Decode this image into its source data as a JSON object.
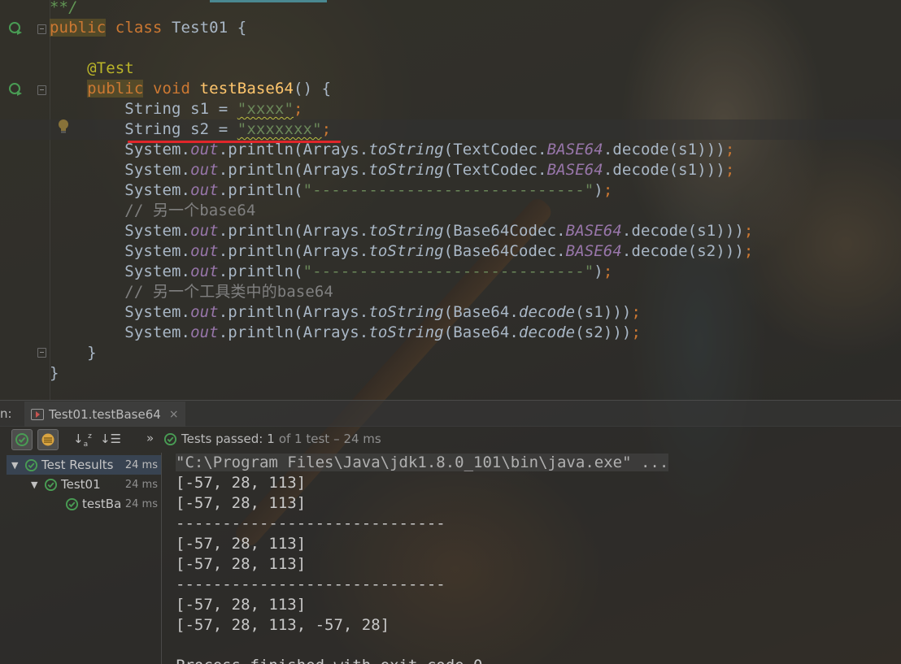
{
  "editor": {
    "lines": [
      [
        {
          "t": "**/",
          "c": "doc"
        }
      ],
      [
        {
          "t": "public",
          "c": "kw hl"
        },
        {
          "t": " "
        },
        {
          "t": "class",
          "c": "kw"
        },
        {
          "t": " Test01 {"
        }
      ],
      [],
      [
        {
          "t": "    @Test",
          "c": "ann"
        }
      ],
      [
        {
          "t": "    "
        },
        {
          "t": "public",
          "c": "kw hl"
        },
        {
          "t": " "
        },
        {
          "t": "void",
          "c": "kw"
        },
        {
          "t": " "
        },
        {
          "t": "testBase64",
          "c": "fn"
        },
        {
          "t": "() {"
        }
      ],
      [
        {
          "t": "        String s1 = "
        },
        {
          "t": "\"xxxx\"",
          "c": "str warn"
        },
        {
          "t": ";",
          "c": "punc"
        }
      ],
      [
        {
          "t": "        String s2 = "
        },
        {
          "t": "\"xxxxxxx\"",
          "c": "str warn"
        },
        {
          "t": ";",
          "c": "punc"
        }
      ],
      [
        {
          "t": "        System."
        },
        {
          "t": "out",
          "c": "field"
        },
        {
          "t": ".println(Arrays."
        },
        {
          "t": "toString",
          "c": "static"
        },
        {
          "t": "(TextCodec."
        },
        {
          "t": "BASE64",
          "c": "field"
        },
        {
          "t": ".decode(s1)))"
        },
        {
          "t": ";",
          "c": "punc"
        }
      ],
      [
        {
          "t": "        System."
        },
        {
          "t": "out",
          "c": "field"
        },
        {
          "t": ".println(Arrays."
        },
        {
          "t": "toString",
          "c": "static"
        },
        {
          "t": "(TextCodec."
        },
        {
          "t": "BASE64",
          "c": "field"
        },
        {
          "t": ".decode(s1)))"
        },
        {
          "t": ";",
          "c": "punc"
        }
      ],
      [
        {
          "t": "        System."
        },
        {
          "t": "out",
          "c": "field"
        },
        {
          "t": ".println("
        },
        {
          "t": "\"-----------------------------\"",
          "c": "str"
        },
        {
          "t": ")"
        },
        {
          "t": ";",
          "c": "punc"
        }
      ],
      [
        {
          "t": "        // 另一个base64",
          "c": "comment"
        }
      ],
      [
        {
          "t": "        System."
        },
        {
          "t": "out",
          "c": "field"
        },
        {
          "t": ".println(Arrays."
        },
        {
          "t": "toString",
          "c": "static"
        },
        {
          "t": "(Base64Codec."
        },
        {
          "t": "BASE64",
          "c": "field"
        },
        {
          "t": ".decode(s1)))"
        },
        {
          "t": ";",
          "c": "punc"
        }
      ],
      [
        {
          "t": "        System."
        },
        {
          "t": "out",
          "c": "field"
        },
        {
          "t": ".println(Arrays."
        },
        {
          "t": "toString",
          "c": "static"
        },
        {
          "t": "(Base64Codec."
        },
        {
          "t": "BASE64",
          "c": "field"
        },
        {
          "t": ".decode(s2)))"
        },
        {
          "t": ";",
          "c": "punc"
        }
      ],
      [
        {
          "t": "        System."
        },
        {
          "t": "out",
          "c": "field"
        },
        {
          "t": ".println("
        },
        {
          "t": "\"-----------------------------\"",
          "c": "str"
        },
        {
          "t": ")"
        },
        {
          "t": ";",
          "c": "punc"
        }
      ],
      [
        {
          "t": "        // 另一个工具类中的base64",
          "c": "comment"
        }
      ],
      [
        {
          "t": "        System."
        },
        {
          "t": "out",
          "c": "field"
        },
        {
          "t": ".println(Arrays."
        },
        {
          "t": "toString",
          "c": "static"
        },
        {
          "t": "(Base64."
        },
        {
          "t": "decode",
          "c": "static"
        },
        {
          "t": "(s1)))"
        },
        {
          "t": ";",
          "c": "punc"
        }
      ],
      [
        {
          "t": "        System."
        },
        {
          "t": "out",
          "c": "field"
        },
        {
          "t": ".println(Arrays."
        },
        {
          "t": "toString",
          "c": "static"
        },
        {
          "t": "(Base64."
        },
        {
          "t": "decode",
          "c": "static"
        },
        {
          "t": "(s2)))"
        },
        {
          "t": ";",
          "c": "punc"
        }
      ],
      [
        {
          "t": "    }"
        }
      ],
      [
        {
          "t": "}"
        }
      ]
    ]
  },
  "run": {
    "label": "n:",
    "tab_title": "Test01.testBase64",
    "tab_close": "×",
    "more": "»",
    "status_prefix": "Tests passed:",
    "status_count": "1",
    "status_of": "of 1 test",
    "status_time": "– 24 ms",
    "sort_alpha_icon": "sort-alphabetically-icon",
    "sort_duration_icon": "sort-by-duration-icon"
  },
  "tree": {
    "root": {
      "label": "Test Results",
      "time": "24 ms"
    },
    "suite": {
      "label": "Test01",
      "time": "24 ms"
    },
    "test": {
      "label": "testBa",
      "time": "24 ms"
    }
  },
  "console": {
    "lines": [
      "\"C:\\Program Files\\Java\\jdk1.8.0_101\\bin\\java.exe\" ...",
      "[-57, 28, 113]",
      "[-57, 28, 113]",
      "-----------------------------",
      "[-57, 28, 113]",
      "[-57, 28, 113]",
      "-----------------------------",
      "[-57, 28, 113]",
      "[-57, 28, 113, -57, 28]",
      "",
      "Process finished with exit code 0"
    ]
  },
  "colors": {
    "keyword": "#cc7832",
    "string": "#6a8759",
    "field": "#9876aa",
    "method": "#ffc66d",
    "annotation": "#bbb529",
    "comment": "#808080",
    "pass_green": "#499c54",
    "error_underline": "#e0262a"
  }
}
